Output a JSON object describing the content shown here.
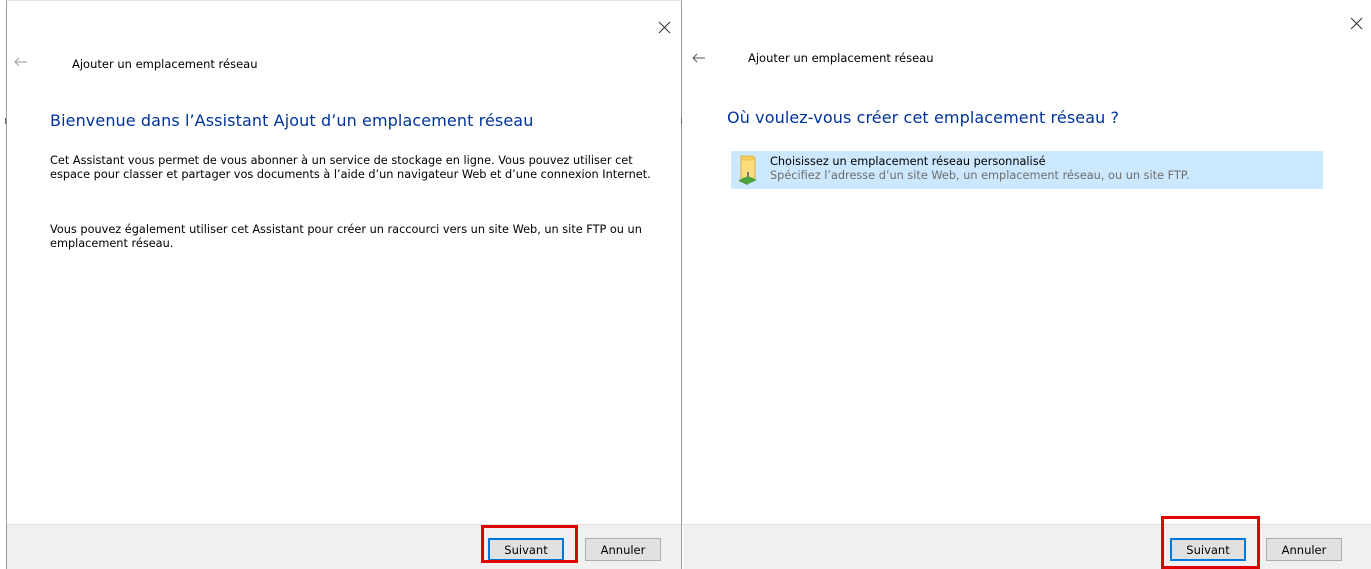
{
  "dialog1": {
    "close_label": "✕",
    "back_label": "←",
    "title": "Ajouter un emplacement réseau",
    "heading": "Bienvenue dans l’Assistant Ajout d’un emplacement réseau",
    "paragraph1": "Cet Assistant vous permet de vous abonner à un service de stockage en ligne. Vous pouvez utiliser cet espace pour classer et partager vos documents à l’aide d’un navigateur Web et d’une connexion Internet.",
    "paragraph2": "Vous pouvez également utiliser cet Assistant pour créer un raccourci vers un site Web, un site FTP ou un emplacement réseau.",
    "next_label": "Suivant",
    "cancel_label": "Annuler"
  },
  "dialog2": {
    "close_label": "✕",
    "back_label": "←",
    "title": "Ajouter un emplacement réseau",
    "heading": "Où voulez-vous créer cet emplacement réseau ?",
    "option_title": "Choisissez un emplacement réseau personnalisé",
    "option_description": "Spécifiez l’adresse d’un site Web, un emplacement réseau, ou un site FTP.",
    "option_icon": "network-folder-icon",
    "next_label": "Suivant",
    "cancel_label": "Annuler"
  },
  "colors": {
    "heading": "#003399",
    "selection": "#cce8ff",
    "highlight": "#e00000",
    "primary_border": "#0078d7"
  }
}
